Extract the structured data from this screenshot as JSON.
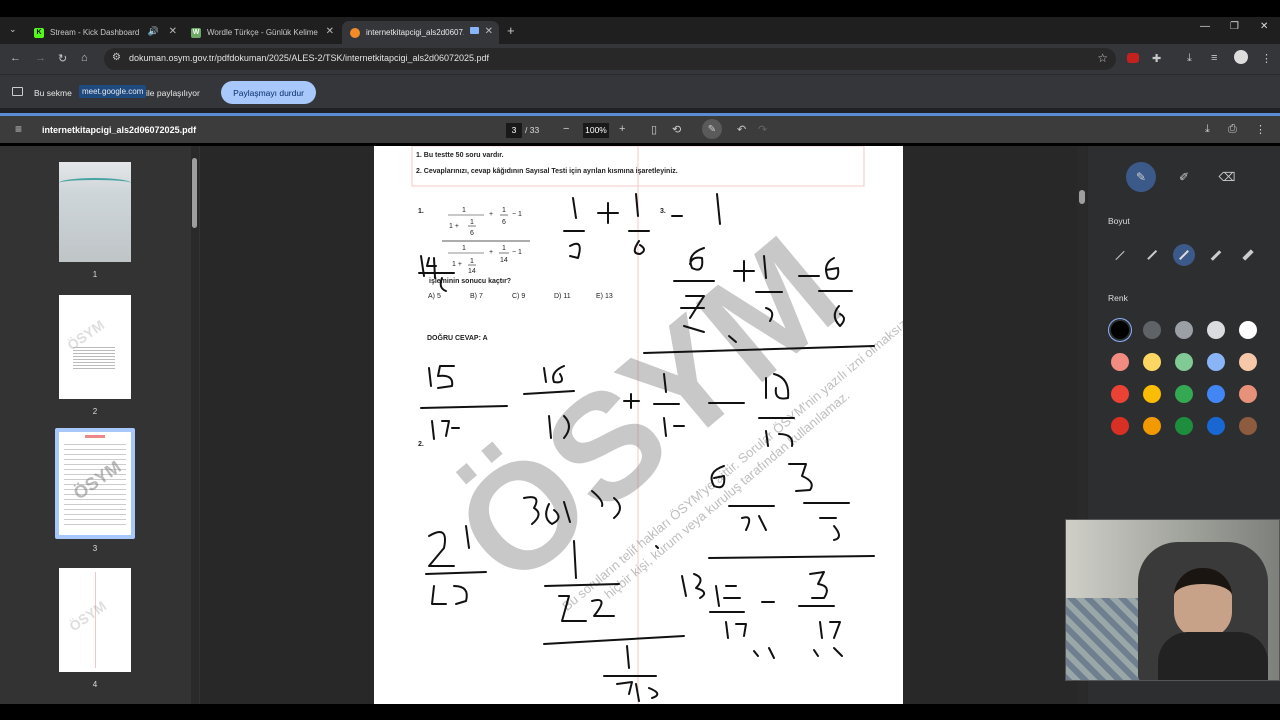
{
  "tabs": [
    {
      "title": "Stream - Kick Dashboard",
      "favicon": "kick-icon",
      "color": "#53fc18",
      "audio": true
    },
    {
      "title": "Wordle Türkçe - Günlük Kelime",
      "favicon": "wordle-icon",
      "color": "#6aaa64"
    },
    {
      "title": "internetkitapcigi_als2d0607...",
      "favicon": "osym-icon",
      "color": "#f28c28",
      "active": true
    }
  ],
  "address": {
    "url": "dokuman.osym.gov.tr/pdfdokuman/2025/ALES-2/TSK/internetkitapcigi_als2d06072025.pdf"
  },
  "share_bar": {
    "prefix": "Bu sekme",
    "domain": "meet.google.com",
    "suffix": "ile paylaşılıyor",
    "stop_label": "Paylaşmayı durdur"
  },
  "pdf": {
    "filename": "internetkitapcigi_als2d06072025.pdf",
    "current_page": "3",
    "total_pages": "/ 33",
    "zoom": "100%",
    "thumbnails": [
      "1",
      "2",
      "3",
      "4"
    ],
    "instructions": [
      "1. Bu testte 50 soru vardır.",
      "2. Cevaplarınızı, cevap kâğıdının Sayısal Testi için ayrılan kısmına işaretleyiniz."
    ],
    "question1": {
      "number": "1.",
      "prompt": "işleminin sonucu kaçtır?",
      "options": [
        "A) 5",
        "B) 7",
        "C) 9",
        "D) 11",
        "E) 13"
      ]
    },
    "answer": "DOĞRU CEVAP: A",
    "question2_number": "2.",
    "watermark": "ÖSYM",
    "watermark_note_1": "Bu soruların telif hakları ÖSYM'ye aittir. Sorular ÖSYM'nin yazılı izni olmaksızın",
    "watermark_note_2": "hiçbir kişi, kurum veya kuruluş tarafından kullanılamaz."
  },
  "annotation_panel": {
    "size_label": "Boyut",
    "color_label": "Renk",
    "colors": [
      [
        "#000000",
        "#5f6368",
        "#9aa0a6",
        "#dadce0",
        "#ffffff"
      ],
      [
        "#f28b82",
        "#fdd663",
        "#81c995",
        "#8ab4f8",
        "#f6c7a9"
      ],
      [
        "#ea4335",
        "#fbbc04",
        "#34a853",
        "#4285f4",
        "#e8917a"
      ],
      [
        "#d93025",
        "#f29900",
        "#1e8e3e",
        "#1967d2",
        "#8d5b3f"
      ]
    ]
  }
}
